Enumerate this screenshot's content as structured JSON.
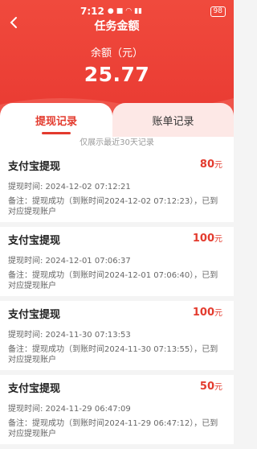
{
  "status_bar": {
    "time": "7:12",
    "icons": [
      "notification-icon",
      "app-icon",
      "wifi-icon",
      "signal-icon"
    ],
    "battery": "98"
  },
  "header": {
    "title": "任务金额",
    "balance_label": "余额（元）",
    "balance_amount": "25.77"
  },
  "tabs": [
    {
      "label": "提现记录",
      "active": true
    },
    {
      "label": "账单记录",
      "active": false
    }
  ],
  "notice": "仅展示最近30天记录",
  "records": [
    {
      "title": "支付宝提现",
      "amount": "80",
      "unit": "元",
      "time": "提现时间: 2024-12-02 07:12:21",
      "note": "备注：提现成功（到账时间2024-12-02 07:12:23），已到对应提现账户"
    },
    {
      "title": "支付宝提现",
      "amount": "100",
      "unit": "元",
      "time": "提现时间: 2024-12-01 07:06:37",
      "note": "备注：提现成功（到账时间2024-12-01 07:06:40），已到对应提现账户"
    },
    {
      "title": "支付宝提现",
      "amount": "100",
      "unit": "元",
      "time": "提现时间: 2024-11-30 07:13:53",
      "note": "备注：提现成功（到账时间2024-11-30 07:13:55），已到对应提现账户"
    },
    {
      "title": "支付宝提现",
      "amount": "50",
      "unit": "元",
      "time": "提现时间: 2024-11-29 06:47:09",
      "note": "备注：提现成功（到账时间2024-11-29 06:47:12），已到对应提现账户"
    }
  ],
  "colors": {
    "brand": "#e93a32",
    "accent_text": "#e33b2e",
    "tab_inactive_bg": "#fde8e6"
  }
}
